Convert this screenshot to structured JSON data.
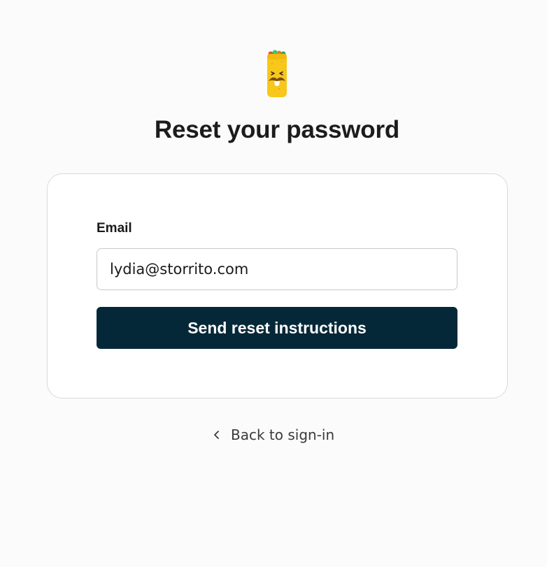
{
  "brand": {
    "logo_icon": "burrito-mascot-icon",
    "colors": {
      "wrap": "#f7c71b",
      "mustache": "#7a4b1a",
      "primary_button": "#052839"
    }
  },
  "header": {
    "title": "Reset your password"
  },
  "form": {
    "email_label": "Email",
    "email_value": "lydia@storrito.com",
    "submit_label": "Send reset instructions"
  },
  "footer": {
    "back_icon": "chevron-left-icon",
    "back_label": "Back to sign-in"
  }
}
